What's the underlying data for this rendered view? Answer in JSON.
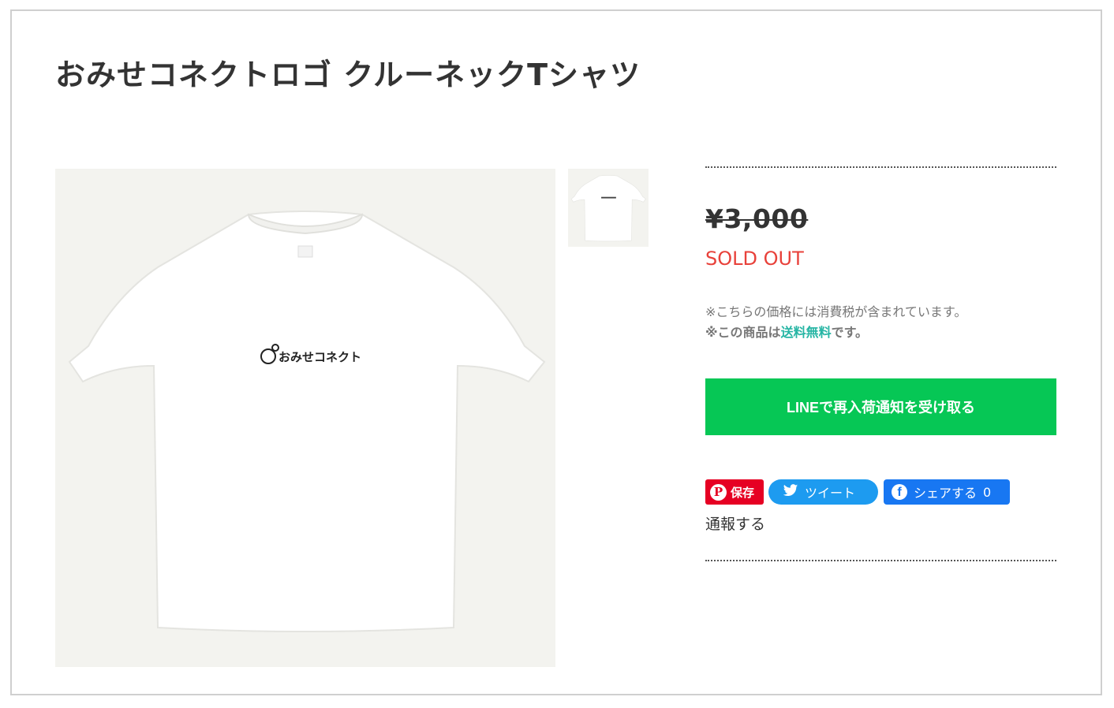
{
  "product": {
    "title": "おみせコネクトロゴ クルーネックTシャツ",
    "logo_text": "おみせコネクト",
    "price": "¥3,000",
    "status": "SOLD OUT",
    "tax_note": "※こちらの価格には消費税が含まれています。",
    "shipping_prefix": "※この商品は",
    "shipping_highlight": "送料無料",
    "shipping_suffix": "です。"
  },
  "actions": {
    "line_notify_label": "LINEで再入荷通知を受け取る",
    "pinterest_label": "保存",
    "twitter_label": "ツイート",
    "facebook_label": "シェアする",
    "facebook_count": "0",
    "report_label": "通報する"
  },
  "colors": {
    "sold_out": "#e8413a",
    "line_green": "#06c755",
    "shipping_highlight": "#26b5a4",
    "pinterest": "#e60023",
    "twitter": "#1d9bf0",
    "facebook": "#1877f2"
  },
  "icons": {
    "pinterest": "pinterest-icon",
    "twitter": "twitter-bird-icon",
    "facebook": "facebook-icon"
  }
}
